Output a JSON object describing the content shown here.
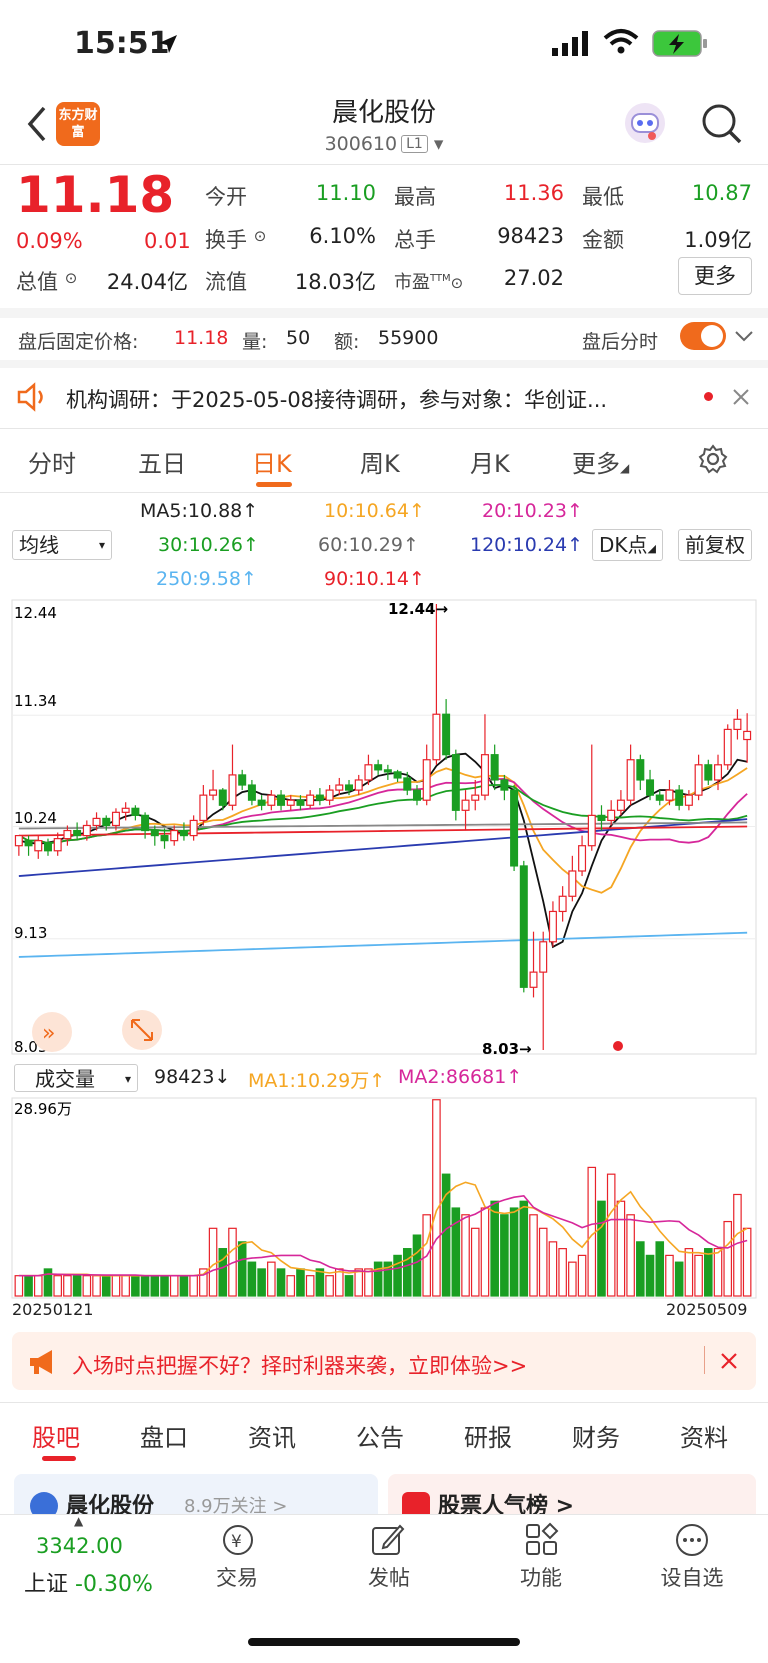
{
  "status": {
    "time": "15:51"
  },
  "header": {
    "logo_text": "东方财富",
    "title": "晨化股份",
    "code": "300610",
    "level": "L1"
  },
  "quote": {
    "price": "11.18",
    "change_pct": "0.09%",
    "change": "0.01",
    "open_label": "今开",
    "open": "11.10",
    "high_label": "最高",
    "high": "11.36",
    "low_label": "最低",
    "low": "10.87",
    "turnover_label": "换手",
    "turnover": "6.10%",
    "volume_label": "总手",
    "volume": "98423",
    "amount_label": "金额",
    "amount": "1.09亿",
    "mktcap_label": "总值",
    "mktcap": "24.04亿",
    "float_label": "流值",
    "float": "18.03亿",
    "pe_label": "市盈",
    "pe_sup": "TTM",
    "pe": "27.02",
    "more": "更多"
  },
  "afterhours": {
    "label": "盘后固定价格:",
    "price": "11.18",
    "vol_label": "量:",
    "vol": "50",
    "amt_label": "额:",
    "amt": "55900",
    "toggle_label": "盘后分时"
  },
  "notice": {
    "text": "机构调研：于2025-05-08接待调研，参与对象：华创证..."
  },
  "ktabs": [
    "分时",
    "五日",
    "日K",
    "周K",
    "月K",
    "更多"
  ],
  "ma_panel": {
    "select": "均线",
    "ma5": "MA5:10.88",
    "ma10": "10:10.64",
    "ma20": "20:10.23",
    "ma30": "30:10.26",
    "ma60": "60:10.29",
    "ma120": "120:10.24",
    "ma250": "250:9.58",
    "ma90": "90:10.14",
    "dk": "DK点",
    "fq": "前复权"
  },
  "chart_labels": {
    "y_top": "12.44",
    "y_mid1": "11.34",
    "y_mid2": "10.24",
    "y_mid3": "9.13",
    "y_bot": "8.03",
    "max_mark": "12.44→",
    "min_mark": "8.03→"
  },
  "vol_panel": {
    "select": "成交量",
    "value": "98423",
    "ma1": "MA1:10.29万",
    "ma2": "MA2:86681",
    "max": "28.96万",
    "date_start": "20250121",
    "date_end": "20250509"
  },
  "banner": {
    "text": "入场时点把握不好？择时利器来袭，立即体验>>"
  },
  "bottom_tabs": [
    "股吧",
    "盘口",
    "资讯",
    "公告",
    "研报",
    "财务",
    "资料"
  ],
  "cards": {
    "left": "晨化股份",
    "left_sub": "8.9万关注 >",
    "right": "股票人气榜 >"
  },
  "nav": {
    "index_value": "3342.00",
    "index_name": "上证",
    "index_change": "-0.30%",
    "trade": "交易",
    "post": "发帖",
    "func": "功能",
    "watch": "设自选"
  },
  "chart_data": {
    "type": "candlestick",
    "ylim": [
      8.03,
      12.44
    ],
    "candles": [
      [
        10.05,
        10.15,
        9.95,
        10.1
      ],
      [
        10.1,
        10.05,
        9.95,
        10.15
      ],
      [
        10.0,
        10.1,
        9.92,
        10.15
      ],
      [
        10.08,
        10.0,
        9.95,
        10.12
      ],
      [
        10.0,
        10.12,
        9.95,
        10.18
      ],
      [
        10.12,
        10.2,
        10.05,
        10.25
      ],
      [
        10.2,
        10.15,
        10.1,
        10.28
      ],
      [
        10.15,
        10.25,
        10.1,
        10.3
      ],
      [
        10.25,
        10.32,
        10.2,
        10.38
      ],
      [
        10.32,
        10.25,
        10.2,
        10.35
      ],
      [
        10.25,
        10.38,
        10.2,
        10.42
      ],
      [
        10.38,
        10.42,
        10.3,
        10.48
      ],
      [
        10.42,
        10.35,
        10.3,
        10.45
      ],
      [
        10.35,
        10.2,
        10.12,
        10.38
      ],
      [
        10.2,
        10.15,
        10.05,
        10.25
      ],
      [
        10.15,
        10.1,
        10.02,
        10.22
      ],
      [
        10.1,
        10.2,
        10.05,
        10.25
      ],
      [
        10.2,
        10.15,
        10.1,
        10.28
      ],
      [
        10.15,
        10.3,
        10.1,
        10.35
      ],
      [
        10.3,
        10.55,
        10.25,
        10.65
      ],
      [
        10.55,
        10.6,
        10.5,
        10.8
      ],
      [
        10.6,
        10.45,
        10.4,
        10.62
      ],
      [
        10.45,
        10.75,
        10.4,
        11.05
      ],
      [
        10.75,
        10.65,
        10.6,
        10.8
      ],
      [
        10.65,
        10.5,
        10.45,
        10.7
      ],
      [
        10.5,
        10.45,
        10.4,
        10.55
      ],
      [
        10.45,
        10.55,
        10.4,
        10.6
      ],
      [
        10.55,
        10.45,
        10.4,
        10.6
      ],
      [
        10.45,
        10.5,
        10.4,
        10.55
      ],
      [
        10.5,
        10.45,
        10.4,
        10.55
      ],
      [
        10.45,
        10.55,
        10.42,
        10.6
      ],
      [
        10.55,
        10.5,
        10.45,
        10.62
      ],
      [
        10.5,
        10.6,
        10.45,
        10.65
      ],
      [
        10.6,
        10.65,
        10.55,
        10.72
      ],
      [
        10.65,
        10.6,
        10.55,
        10.7
      ],
      [
        10.6,
        10.7,
        10.55,
        10.75
      ],
      [
        10.7,
        10.85,
        10.65,
        10.95
      ],
      [
        10.85,
        10.8,
        10.75,
        10.9
      ],
      [
        10.8,
        10.78,
        10.7,
        10.85
      ],
      [
        10.78,
        10.72,
        10.68,
        10.8
      ],
      [
        10.72,
        10.6,
        10.55,
        10.78
      ],
      [
        10.6,
        10.5,
        10.45,
        10.65
      ],
      [
        10.5,
        10.9,
        10.45,
        11.05
      ],
      [
        10.9,
        11.35,
        10.85,
        12.44
      ],
      [
        11.35,
        10.95,
        10.9,
        11.5
      ],
      [
        10.95,
        10.4,
        10.3,
        11.0
      ],
      [
        10.4,
        10.5,
        10.2,
        10.6
      ],
      [
        10.5,
        10.55,
        10.4,
        10.7
      ],
      [
        10.55,
        10.95,
        10.5,
        11.35
      ],
      [
        10.95,
        10.7,
        10.6,
        11.05
      ],
      [
        10.7,
        10.6,
        10.5,
        10.75
      ],
      [
        10.6,
        9.85,
        9.8,
        10.65
      ],
      [
        9.85,
        8.65,
        8.6,
        9.9
      ],
      [
        8.65,
        8.8,
        8.55,
        9.2
      ],
      [
        8.8,
        9.1,
        8.03,
        9.2
      ],
      [
        9.1,
        9.4,
        9.05,
        9.5
      ],
      [
        9.4,
        9.55,
        9.3,
        9.65
      ],
      [
        9.55,
        9.8,
        9.5,
        9.95
      ],
      [
        9.8,
        10.05,
        9.75,
        10.15
      ],
      [
        10.05,
        10.35,
        10.0,
        11.05
      ],
      [
        10.35,
        10.3,
        10.2,
        10.45
      ],
      [
        10.3,
        10.4,
        10.25,
        10.5
      ],
      [
        10.4,
        10.5,
        10.35,
        10.6
      ],
      [
        10.5,
        10.9,
        10.45,
        11.05
      ],
      [
        10.9,
        10.7,
        10.6,
        10.95
      ],
      [
        10.7,
        10.55,
        10.5,
        10.8
      ],
      [
        10.55,
        10.5,
        10.45,
        10.6
      ],
      [
        10.5,
        10.6,
        10.45,
        10.7
      ],
      [
        10.6,
        10.45,
        10.4,
        10.65
      ],
      [
        10.45,
        10.55,
        10.4,
        10.6
      ],
      [
        10.55,
        10.85,
        10.5,
        10.95
      ],
      [
        10.85,
        10.7,
        10.65,
        10.9
      ],
      [
        10.7,
        10.85,
        10.6,
        10.95
      ],
      [
        10.85,
        11.2,
        10.8,
        11.25
      ],
      [
        11.2,
        11.3,
        11.1,
        11.4
      ],
      [
        11.1,
        11.18,
        10.87,
        11.36
      ]
    ],
    "ma5": [
      10.1,
      10.08,
      10.07,
      10.08,
      10.1,
      10.14,
      10.16,
      10.18,
      10.22,
      10.26,
      10.3,
      10.34,
      10.36,
      10.34,
      10.3,
      10.24,
      10.2,
      10.16,
      10.18,
      10.28,
      10.36,
      10.42,
      10.52,
      10.58,
      10.6,
      10.56,
      10.55,
      10.52,
      10.5,
      10.5,
      10.5,
      10.5,
      10.52,
      10.56,
      10.58,
      10.62,
      10.68,
      10.74,
      10.76,
      10.77,
      10.75,
      10.68,
      10.7,
      10.84,
      10.92,
      10.95,
      10.96,
      10.88,
      10.78,
      10.62,
      10.65,
      10.6,
      10.3,
      9.9,
      9.5,
      9.05,
      9.1,
      9.4,
      9.58,
      9.85,
      10.1,
      10.25,
      10.35,
      10.45,
      10.5,
      10.55,
      10.6,
      10.6,
      10.57,
      10.55,
      10.58,
      10.62,
      10.68,
      10.76,
      10.9,
      10.88
    ]
  },
  "volume_data": {
    "ymax": 28.96,
    "bars": [
      3,
      3,
      3,
      4,
      3,
      3,
      3,
      3,
      3,
      3,
      3,
      3,
      3,
      3,
      3,
      3,
      3,
      3,
      3,
      4,
      10,
      7,
      10,
      8,
      5,
      4,
      5,
      4,
      3,
      4,
      3,
      4,
      3,
      4,
      3,
      4,
      4,
      5,
      5,
      6,
      7,
      9,
      12,
      29,
      18,
      13,
      12,
      10,
      13,
      14,
      12,
      13,
      14,
      12,
      10,
      8,
      7,
      5,
      6,
      19,
      14,
      18,
      14,
      12,
      8,
      6,
      8,
      6,
      5,
      7,
      6,
      7,
      7,
      11,
      15,
      10
    ],
    "up": [
      1,
      0,
      1,
      0,
      1,
      1,
      0,
      1,
      1,
      0,
      1,
      1,
      0,
      0,
      0,
      0,
      1,
      0,
      1,
      1,
      1,
      0,
      1,
      0,
      0,
      0,
      1,
      0,
      1,
      0,
      1,
      0,
      1,
      1,
      0,
      1,
      1,
      0,
      0,
      0,
      0,
      0,
      1,
      1,
      0,
      0,
      1,
      1,
      1,
      0,
      0,
      0,
      0,
      1,
      1,
      1,
      1,
      1,
      1,
      1,
      0,
      1,
      1,
      1,
      0,
      0,
      0,
      1,
      0,
      1,
      1,
      0,
      1,
      1,
      1,
      1
    ]
  }
}
